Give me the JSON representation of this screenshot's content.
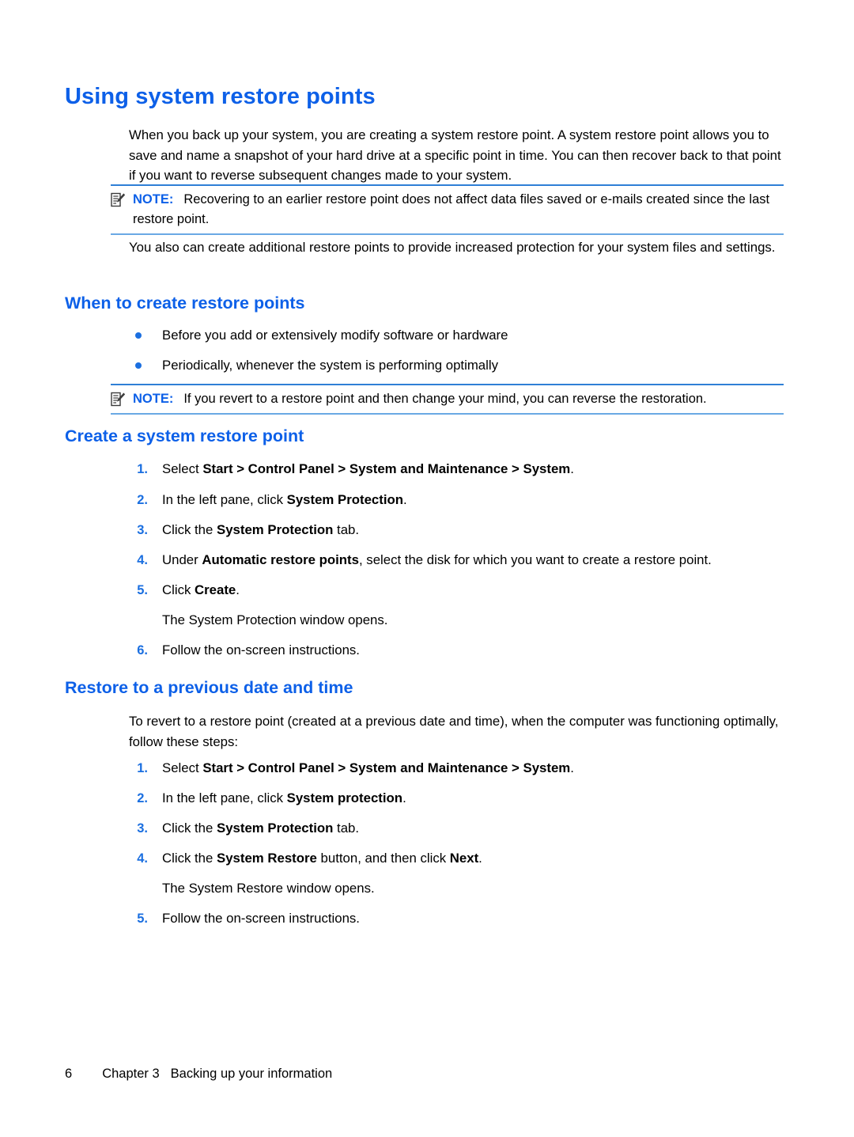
{
  "page": {
    "title": "Using system restore points",
    "footer": {
      "page_number": "6",
      "chapter": "Chapter 3",
      "chapter_title": "Backing up your information"
    },
    "colors": {
      "heading_blue": "#0d60e8",
      "marker_blue": "#1b6fe0",
      "note_rule_top": "#2f7fd6",
      "note_rule_bottom": "#6aa9e4",
      "body_black": "#000000"
    }
  },
  "intro": {
    "paragraph": "When you back up your system, you are creating a system restore point. A system restore point allows you to save and name a snapshot of your hard drive at a specific point in time. You can then recover back to that point if you want to reverse subsequent changes made to your system."
  },
  "note1": {
    "icon": "note-pencil-icon",
    "label": "NOTE:",
    "text": "Recovering to an earlier restore point does not affect data files saved or e-mails created since the last restore point."
  },
  "after_note": {
    "paragraph": "You also can create additional restore points to provide increased protection for your system files and settings."
  },
  "section_when": {
    "heading": "When to create restore points",
    "bullets": [
      "Before you add or extensively modify software or hardware",
      "Periodically, whenever the system is performing optimally"
    ]
  },
  "note2": {
    "icon": "note-pencil-icon",
    "label": "NOTE:",
    "text": "If you revert to a restore point and then change your mind, you can reverse the restoration."
  },
  "section_create": {
    "heading": "Create a system restore point",
    "steps": [
      {
        "num": "1.",
        "pre": "Select ",
        "bold": "Start > Control Panel > System and Maintenance > System",
        "post": "."
      },
      {
        "num": "2.",
        "pre": "In the left pane, click ",
        "bold": "System Protection",
        "post": "."
      },
      {
        "num": "3.",
        "pre": "Click the ",
        "bold": "System Protection",
        "post": " tab."
      },
      {
        "num": "4.",
        "pre": "Under ",
        "bold": "Automatic restore points",
        "post": ", select the disk for which you want to create a restore point."
      },
      {
        "num": "5.",
        "pre": "Click ",
        "bold": "Create",
        "post": "."
      }
    ],
    "result_text": "The System Protection window opens.",
    "final_step": {
      "num": "6.",
      "pre": "Follow the on-screen instructions.",
      "bold": "",
      "post": ""
    }
  },
  "section_restore": {
    "heading": "Restore to a previous date and time",
    "paragraph": "To revert to a restore point (created at a previous date and time), when the computer was functioning optimally, follow these steps:",
    "steps": [
      {
        "num": "1.",
        "pre": "Select ",
        "bold": "Start > Control Panel > System and Maintenance > System",
        "post": "."
      },
      {
        "num": "2.",
        "pre": "In the left pane, click ",
        "bold": "System protection",
        "post": "."
      },
      {
        "num": "3.",
        "pre": "Click the ",
        "bold": "System Protection",
        "post": " tab."
      },
      {
        "num": "4.",
        "pre": "Click the ",
        "bold": "System Restore",
        "post": " button, and then click ",
        "bold2": "Next",
        "post2": "."
      }
    ],
    "result_text": "The System Restore window opens.",
    "final_step": {
      "num": "5.",
      "pre": "Follow the on-screen instructions.",
      "bold": "",
      "post": ""
    }
  }
}
